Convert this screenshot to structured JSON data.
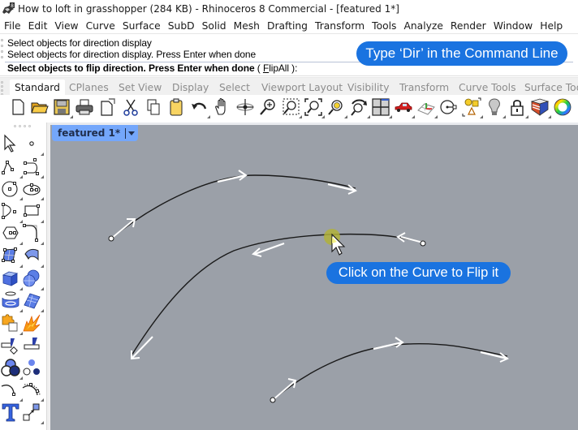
{
  "window": {
    "title": "How to loft in grasshopper (284 KB) - Rhinoceros 8 Commercial - [featured 1*]",
    "app_icon": "rhino-icon"
  },
  "menubar": {
    "items": [
      "File",
      "Edit",
      "View",
      "Curve",
      "Surface",
      "SubD",
      "Solid",
      "Mesh",
      "Drafting",
      "Transform",
      "Tools",
      "Analyze",
      "Render",
      "Window",
      "Help"
    ]
  },
  "command": {
    "history": [
      "Select objects for direction display",
      "Select objects for direction display. Press Enter when done"
    ],
    "prompt": "Select objects to flip direction. Press Enter when done",
    "option_open": " ( ",
    "option_hotkey": "F",
    "option_rest": "lipAll",
    "option_close": " ):"
  },
  "callouts": {
    "type_dir": "Type ‘Dir’ in the Command Line",
    "click_flip": "Click on the Curve to Flip it"
  },
  "toolbar_tabs": {
    "active": "Standard",
    "items": [
      "Standard",
      "CPlanes",
      "Set View",
      "Display",
      "Select",
      "Viewport Layout",
      "Visibility",
      "Transform",
      "Curve Tools",
      "Surface Tools"
    ]
  },
  "toolbar": {
    "icons": [
      "new-file-icon",
      "open-folder-icon",
      "save-icon",
      "print-icon",
      "import-icon",
      "cut-icon",
      "copy-icon",
      "paste-icon",
      "undo-icon",
      "pan-hand-icon",
      "rotate-view-icon",
      "zoom-icon",
      "zoom-window-icon",
      "zoom-extents-icon",
      "zoom-selected-icon",
      "rotate-3d-icon",
      "four-viewports-icon",
      "car-render-icon",
      "cplane-grid-icon",
      "osnap-icon",
      "properties-shapes-icon",
      "light-bulb-icon",
      "lock-icon",
      "materials-icon",
      "color-wheel-icon"
    ]
  },
  "sidebar": {
    "icons": [
      "select-arrow-icon",
      "point-icon",
      "polyline-icon",
      "curve-icon",
      "circle-icon",
      "ellipse-icon",
      "arc-icon",
      "rectangle-icon",
      "polygon-icon",
      "fillet-icon",
      "surface-corner-icon",
      "surface-edge-icon",
      "box-icon",
      "sphere-union-icon",
      "cylinder-icon",
      "mesh-surface-icon",
      "puzzle-icon",
      "explode-icon",
      "split-icon",
      "trim-icon",
      "boolean-icon",
      "points-icon",
      "offset-icon",
      "curve-offset-icon",
      "text-icon",
      "scale-icon"
    ]
  },
  "viewport": {
    "tab_label": "featured 1*",
    "background": "#9ba0a8",
    "tab_color": "#74a7fb",
    "curves": [
      {
        "name": "curve-top",
        "direction": "forward"
      },
      {
        "name": "curve-middle",
        "direction": "reversed"
      },
      {
        "name": "curve-bottom",
        "direction": "forward"
      }
    ]
  },
  "colors": {
    "callout": "#1a73e0",
    "cursor_highlight": "#b2b13a"
  }
}
